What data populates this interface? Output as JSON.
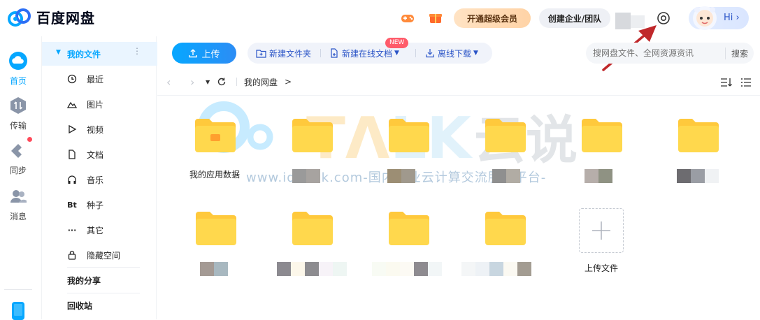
{
  "header": {
    "logo_text": "百度网盘",
    "vip_button": "开通超级会员",
    "enterprise_button": "创建企业/团队",
    "hi_label": "Hi",
    "icons": [
      "game-icon",
      "gift-icon",
      "settings-icon",
      "avatar"
    ]
  },
  "rail": {
    "items": [
      {
        "label": "首页",
        "icon": "cloud-icon",
        "active": true
      },
      {
        "label": "传输",
        "icon": "transfer-icon"
      },
      {
        "label": "同步",
        "icon": "sync-icon",
        "badge": true
      },
      {
        "label": "消息",
        "icon": "message-icon"
      }
    ]
  },
  "sidebar": {
    "root_label": "我的文件",
    "items": [
      {
        "label": "最近",
        "icon": "clock-icon"
      },
      {
        "label": "图片",
        "icon": "image-icon"
      },
      {
        "label": "视频",
        "icon": "video-icon"
      },
      {
        "label": "文档",
        "icon": "document-icon"
      },
      {
        "label": "音乐",
        "icon": "headphones-icon"
      },
      {
        "label": "种子",
        "icon": "torrent-icon",
        "glyph": "Bt"
      },
      {
        "label": "其它",
        "icon": "more-icon",
        "glyph": "···"
      },
      {
        "label": "隐藏空间",
        "icon": "lock-icon"
      }
    ],
    "share_label": "我的分享",
    "recycle_label": "回收站"
  },
  "toolbar": {
    "upload_label": "上传",
    "new_folder_label": "新建文件夹",
    "new_online_doc_label": "新建在线文档",
    "new_badge": "NEW",
    "offline_download_label": "离线下载",
    "search_placeholder": "搜网盘文件、全网资源资讯",
    "search_button": "搜索"
  },
  "breadcrumb": {
    "path": "我的网盘",
    "separator": ">"
  },
  "files": {
    "row1": [
      {
        "name": "我的应用数据",
        "type": "app-folder"
      },
      {
        "name": "",
        "type": "folder"
      },
      {
        "name": "",
        "type": "folder"
      },
      {
        "name": "",
        "type": "folder"
      },
      {
        "name": "",
        "type": "folder"
      },
      {
        "name": "",
        "type": "folder"
      }
    ],
    "row2": [
      {
        "name": "",
        "type": "folder"
      },
      {
        "name": "",
        "type": "folder"
      },
      {
        "name": "",
        "type": "folder"
      },
      {
        "name": "",
        "type": "folder"
      }
    ],
    "upload_tile_label": "上传文件"
  },
  "watermark": {
    "brand": "TALK 云说",
    "url": "www.idctalk.com-国内专业云计算交流服务平台-"
  },
  "colors": {
    "accent": "#06a7ff",
    "folder": "#ffd84d",
    "folder_tab": "#ffc93c",
    "arrow": "#c0282b"
  }
}
